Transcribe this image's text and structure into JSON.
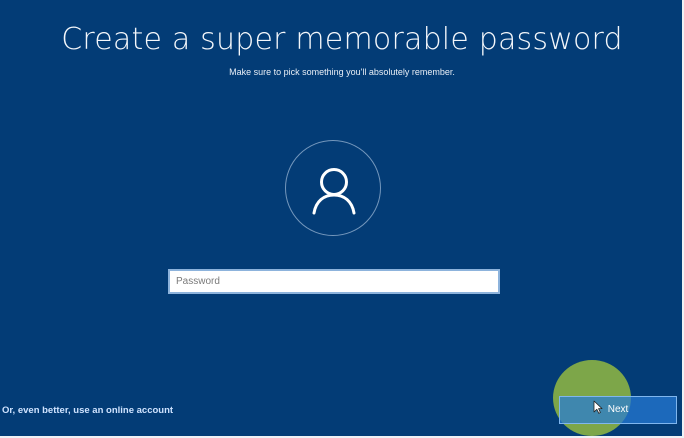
{
  "screen": {
    "title": "Create a super memorable password",
    "subtitle": "Make sure to pick something you'll absolutely remember.",
    "avatar_icon": "user-icon",
    "background_color": "#033c76"
  },
  "password": {
    "placeholder": "Password",
    "value": ""
  },
  "footer": {
    "online_account_link": "Or, even better, use an online account",
    "next_label": "Next",
    "cursor_icon": "mouse-pointer-icon",
    "cursor_highlight_color": "#a0c43c"
  }
}
